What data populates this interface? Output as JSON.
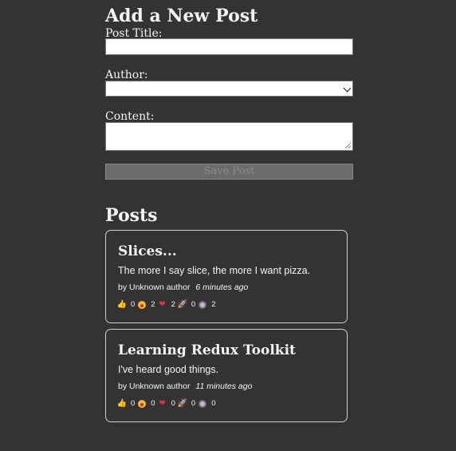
{
  "form": {
    "title": "Add a New Post",
    "post_title_label": "Post Title:",
    "post_title_value": "",
    "author_label": "Author:",
    "author_selected": "",
    "content_label": "Content:",
    "content_value": "",
    "save_label": "Save Post"
  },
  "posts": {
    "heading": "Posts",
    "items": [
      {
        "title": "Slices...",
        "excerpt": "The more I say slice, the more I want pizza.",
        "author": "by Unknown author",
        "time": "6 minutes ago",
        "reactions": {
          "thumbsUp": "0",
          "wow": "2",
          "heart": "2",
          "rocket": "0",
          "coffee": "2"
        }
      },
      {
        "title": "Learning Redux Toolkit",
        "excerpt": "I've heard good things.",
        "author": "by Unknown author",
        "time": "11 minutes ago",
        "reactions": {
          "thumbsUp": "0",
          "wow": "0",
          "heart": "0",
          "rocket": "0",
          "coffee": "0"
        }
      }
    ]
  },
  "icons": {
    "thumbs_up": "thumbs-up-icon",
    "wow": "wow-face-icon",
    "heart": "heart-icon",
    "rocket": "rocket-icon",
    "coffee": "coffee-icon"
  }
}
